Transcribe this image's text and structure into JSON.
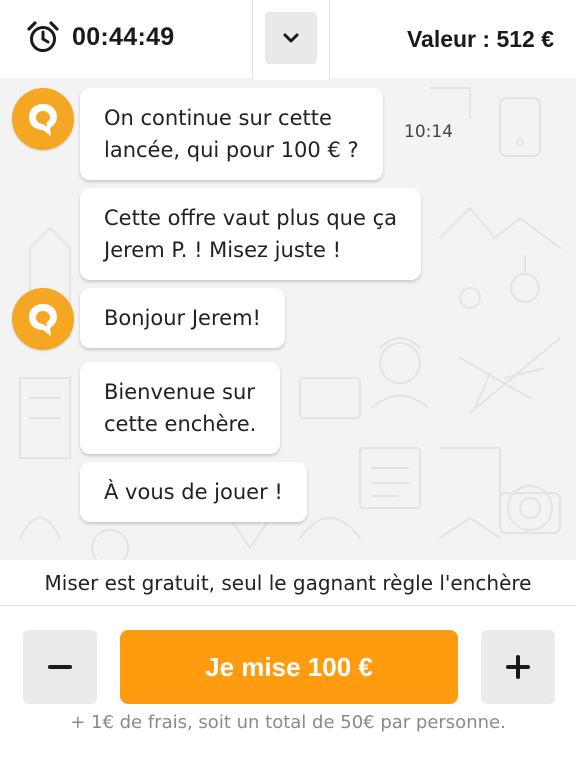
{
  "header": {
    "timer_icon": "alarm-clock-icon",
    "timer": "00:44:49",
    "collapse_icon": "chevron-down-icon",
    "value_label": "Valeur : 512 €"
  },
  "chat": {
    "messages": [
      {
        "text_lines": [
          "On continue sur cette",
          "lancée, qui pour 100 € ?"
        ],
        "time": "10:14",
        "avatar_icon": "auction-logo-icon"
      },
      {
        "text_lines": [
          "Cette offre vaut plus que ça",
          "Jerem P. ! Misez juste !"
        ]
      },
      {
        "text_lines": [
          "Bonjour Jerem!"
        ],
        "avatar_icon": "auction-logo-icon"
      },
      {
        "text_lines": [
          "Bienvenue sur",
          "cette enchère."
        ]
      },
      {
        "text_lines": [
          "À vous de jouer !"
        ]
      }
    ]
  },
  "footer": {
    "notice": "Miser est gratuit, seul le gagnant règle l'enchère",
    "minus_icon": "minus-icon",
    "bid_label": "Je mise 100 €",
    "plus_icon": "plus-icon",
    "fees_note": "+ 1€ de frais, soit un total de 50€ par personne."
  },
  "colors": {
    "accent": "#ff9b0f",
    "avatar": "#f5a623",
    "chat_background": "#f3f3f3",
    "stepper_background": "#ebebeb"
  }
}
